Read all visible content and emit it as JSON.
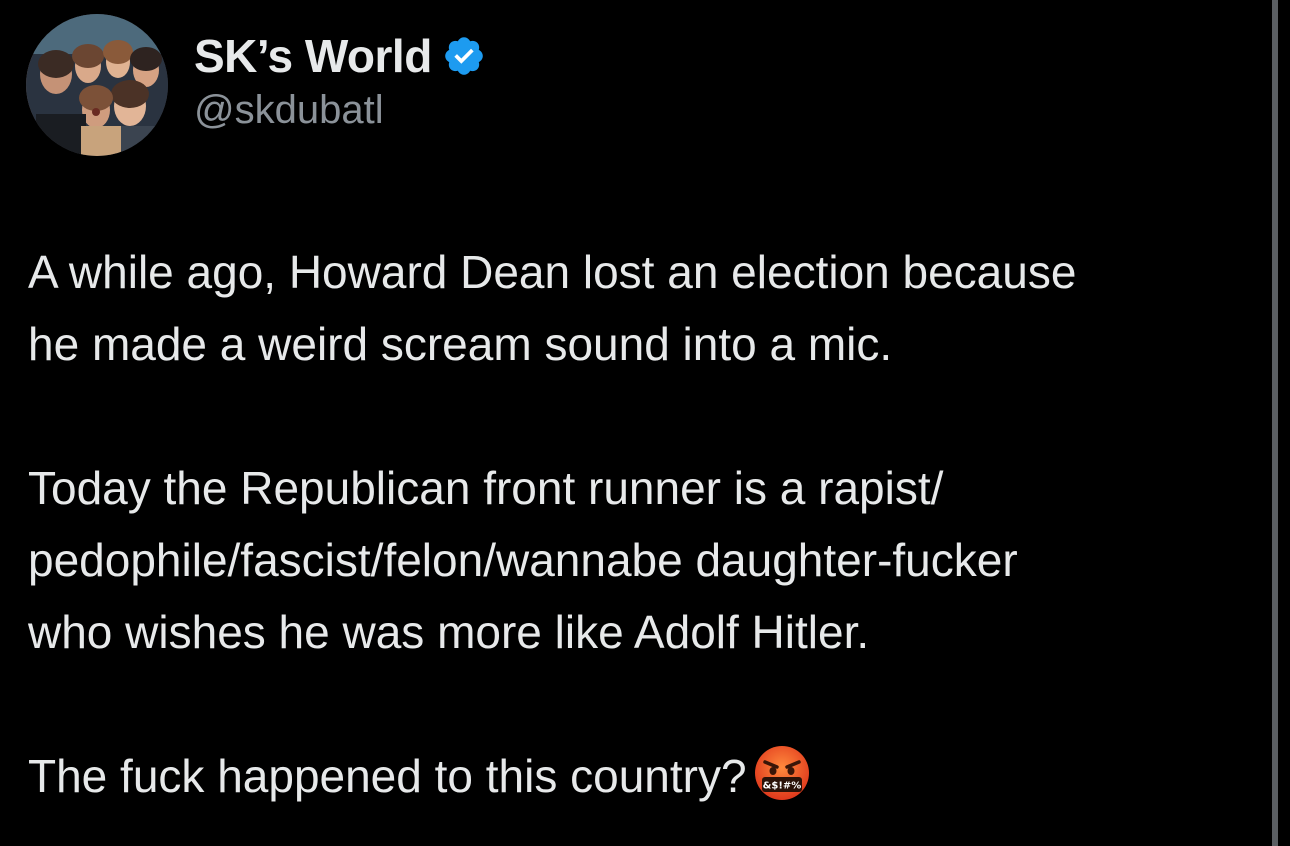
{
  "author": {
    "display_name": "SK’s World",
    "handle": "@skdubatl",
    "verified": true,
    "verified_badge_color": "#1d9bf0"
  },
  "tweet": {
    "paragraphs": [
      "A while ago, Howard Dean lost an election because\nhe made a weird scream sound into a mic.",
      "Today the Republican front runner is a rapist/\npedophile/fascist/felon/wannabe daughter-fucker\nwho wishes he was more like Adolf Hitler.",
      "The fuck happened to this country?"
    ],
    "trailing_emoji": "cursing-face-icon",
    "emoji_text": "&$!#%"
  },
  "colors": {
    "background": "#000000",
    "text_primary": "#e7e9ea",
    "text_secondary": "#8b9299"
  }
}
